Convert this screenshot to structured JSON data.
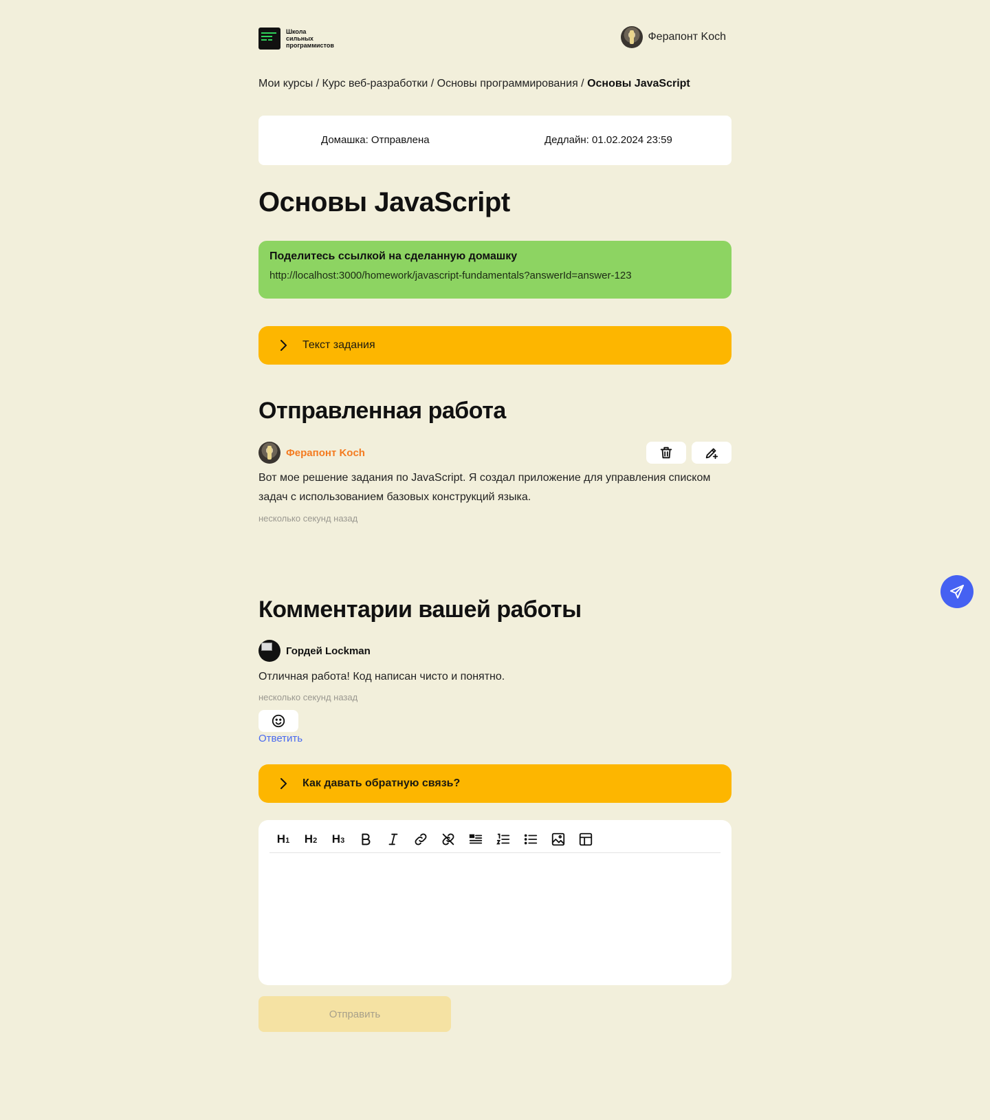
{
  "brand": {
    "logo_lines": [
      "Школа",
      "сильных",
      "программистов"
    ]
  },
  "user": {
    "name": "Ферапонт Koch"
  },
  "breadcrumb": {
    "items": [
      "Мои курсы",
      "Курс веб-разработки",
      "Основы программирования"
    ],
    "separator": " / ",
    "current": "Основы JavaScript"
  },
  "status": {
    "homework": "Домашка: Отправлена",
    "deadline": "Дедлайн: 01.02.2024 23:59"
  },
  "page_title": "Основы JavaScript",
  "share": {
    "heading": "Поделитесь ссылкой на сделанную домашку",
    "url": "http://localhost:3000/homework/javascript-fundamentals?answerId=answer-123"
  },
  "task_accordion": {
    "label": "Текст задания"
  },
  "submitted": {
    "heading": "Отправленная работа",
    "author": "Ферапонт Koch",
    "text": "Вот мое решение задания по JavaScript. Я создал приложение для управления списком задач с использованием базовых конструкций языка.",
    "time": "несколько секунд назад",
    "icons": {
      "delete": "trash-icon",
      "edit": "edit-pencil-icon"
    }
  },
  "comments": {
    "heading": "Комментарии вашей работы",
    "items": [
      {
        "author": "Гордей Lockman",
        "text": "Отличная работа! Код написан чисто и понятно.",
        "time": "несколько секунд назад",
        "reply_label": "Ответить"
      }
    ]
  },
  "feedback_accordion": {
    "label": "Как давать обратную связь?"
  },
  "editor": {
    "toolbar": [
      "H1",
      "H2",
      "H3",
      "bold",
      "italic",
      "link",
      "unlink",
      "blockquote",
      "ordered-list",
      "bullet-list",
      "image",
      "table"
    ],
    "submit_label": "Отправить"
  },
  "colors": {
    "background": "#f2efdb",
    "share_green": "#8dd462",
    "accent_yellow": "#fdb600",
    "author_orange": "#f47b20",
    "link_blue": "#4a6af0",
    "fab_blue": "#4561f2"
  }
}
